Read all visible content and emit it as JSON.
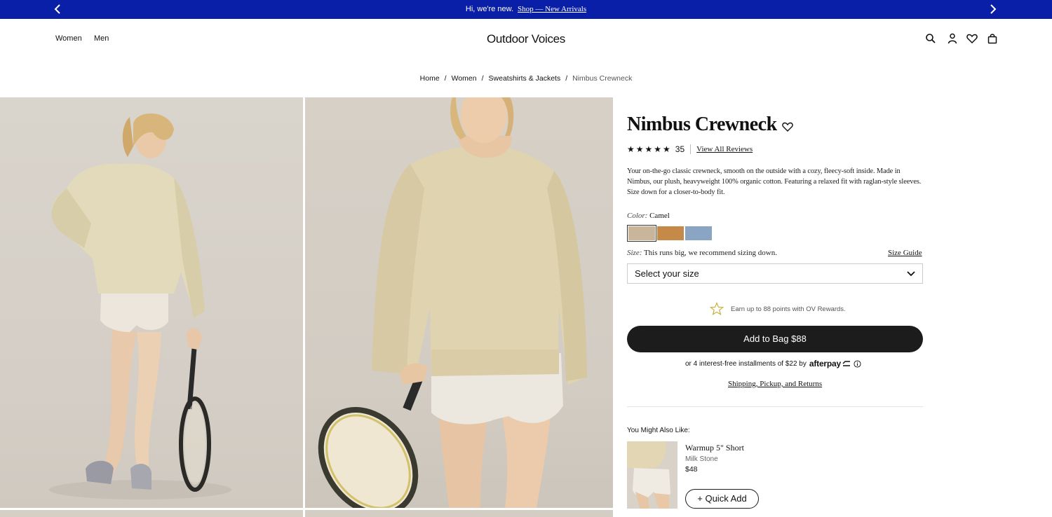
{
  "announcement": {
    "message": "Hi, we're new.",
    "link_text": "Shop — New Arrivals",
    "bg_color": "#0a1fa8",
    "icons": [
      "chevron-left-icon",
      "chevron-right-icon"
    ]
  },
  "header": {
    "nav": [
      "Women",
      "Men"
    ],
    "brand": "Outdoor Voices",
    "icons": [
      "search-icon",
      "account-icon",
      "heart-icon",
      "bag-icon"
    ]
  },
  "breadcrumb": {
    "items": [
      "Home",
      "Women",
      "Sweatshirts & Jackets"
    ],
    "current": "Nimbus Crewneck",
    "separator": "/"
  },
  "product": {
    "title": "Nimbus Crewneck",
    "stars": "★★★★★",
    "rating_value": 5,
    "review_count": "35",
    "view_reviews": "View All Reviews",
    "description": "Your on-the-go classic crewneck, smooth on the outside with a cozy, fleecy-soft inside. Made in Nimbus, our plush, heavyweight 100% organic cotton. Featuring a relaxed fit with raglan-style sleeves. Size down for a closer-to-body fit.",
    "color_label": "Color:",
    "color_value": "Camel",
    "swatches": [
      {
        "name": "Camel",
        "color": "#c8b59a",
        "selected": true
      },
      {
        "name": "Tan",
        "color": "#c68a48",
        "selected": false
      },
      {
        "name": "Blue",
        "color": "#8aa4c4",
        "selected": false
      }
    ],
    "size_label": "Size:",
    "size_note": "This runs big, we recommend sizing down.",
    "size_guide": "Size Guide",
    "size_select": "Select your size",
    "rewards": "Earn up to 88 points with OV Rewards.",
    "add_to_bag": "Add to Bag $88",
    "afterpay_prefix": "or 4 interest-free installments of $22 by",
    "afterpay_logo": "afterpay",
    "shipping": "Shipping, Pickup, and Returns"
  },
  "recommendations": {
    "heading": "You Might Also Like:",
    "items": [
      {
        "name": "Warmup 5\" Short",
        "color": "Milk Stone",
        "price": "$48",
        "button": "+ Quick Add"
      }
    ]
  }
}
